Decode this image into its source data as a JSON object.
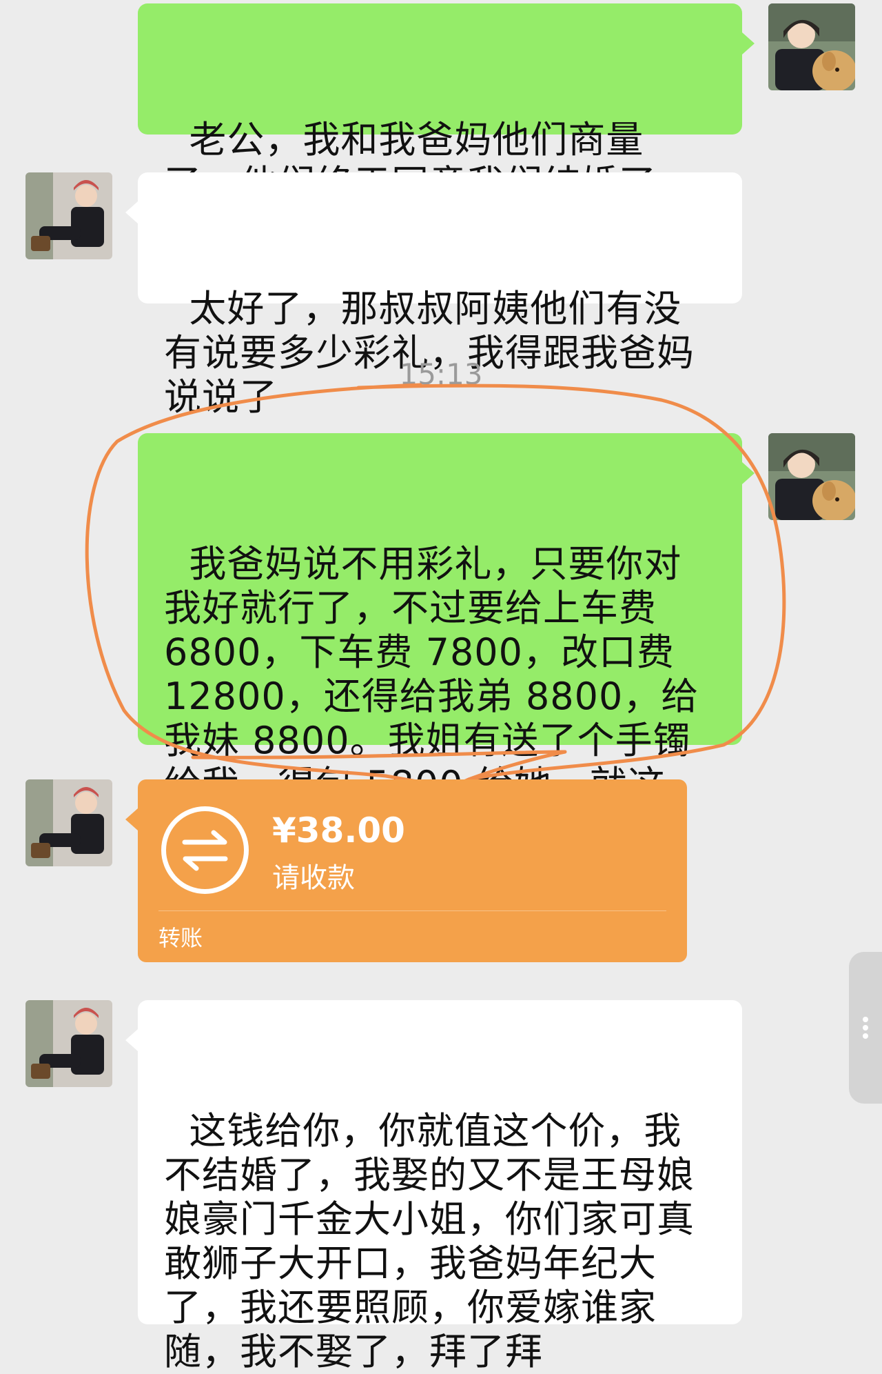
{
  "messages": [
    {
      "sender": "self",
      "text": "老公，我和我爸妈他们商量了，他们终于同意我们结婚了"
    },
    {
      "sender": "other",
      "text": "太好了，那叔叔阿姨他们有没有说要多少彩礼，我得跟我爸妈说说了"
    },
    {
      "timestamp": "15:13"
    },
    {
      "sender": "self",
      "text": "我爸妈说不用彩礼，只要你对我好就行了，不过要给上车费 6800，下车费 7800，改口费 12800，还得给我弟 8800，给我妹 8800。我姐有送了个手镯给我，得包 5800 给她，就这些，你可以先去准备了"
    },
    {
      "sender": "other",
      "transfer": {
        "amount": "¥38.00",
        "note": "请收款",
        "label": "转账"
      }
    },
    {
      "sender": "other",
      "text": "这钱给你，你就值这个价，我不结婚了，我娶的又不是王母娘娘豪门千金大小姐，你们家可真敢狮子大开口，我爸妈年纪大了，我还要照顾，你爱嫁谁家随，我不娶了，拜了拜"
    }
  ],
  "colors": {
    "self_bubble": "#95ec69",
    "other_bubble": "#ffffff",
    "transfer_card": "#f4a14a",
    "annotation_circle": "#f08c4a",
    "background": "#ececec"
  },
  "icons": {
    "transfer": "transfer-arrows-icon",
    "side_handle": "more-vertical-icon"
  }
}
